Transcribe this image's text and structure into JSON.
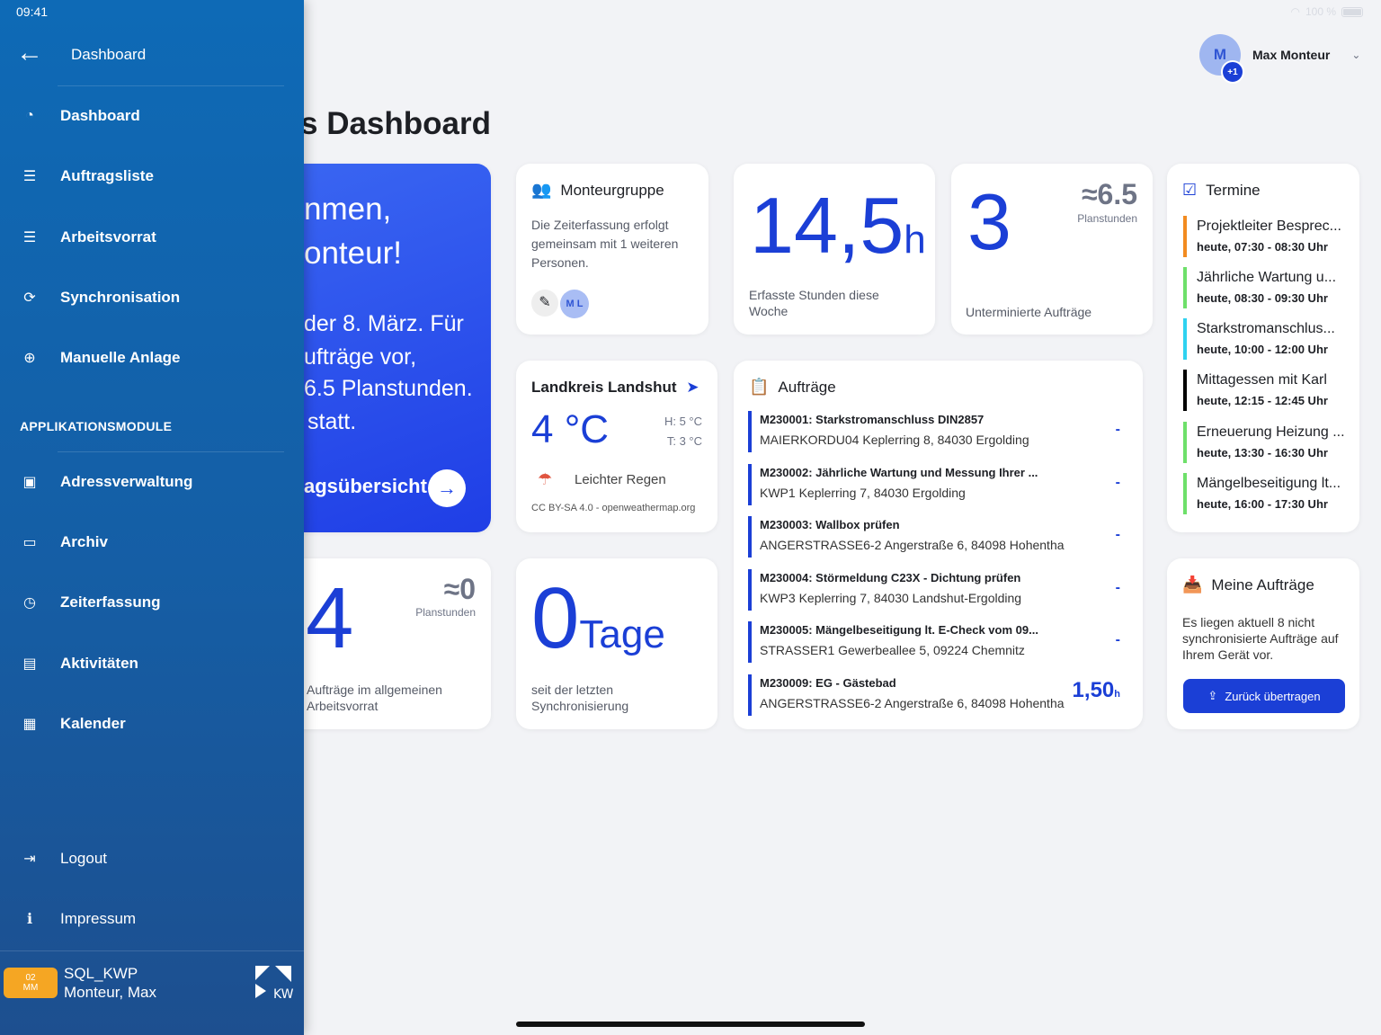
{
  "status": {
    "time": "09:41",
    "battery": "100 %"
  },
  "user": {
    "initial": "M",
    "extra": "+1",
    "name": "Max Monteur"
  },
  "page_title": "s Dashboard",
  "welcome": {
    "line1": "nmen,",
    "line2": "onteur!",
    "line3": "der 8. März. Für",
    "line4": "ufträge vor,",
    "line5": "6.5 Planstunden.",
    "line6": "statt.",
    "link": "agsübersicht"
  },
  "monteurgruppe": {
    "title": "Monteurgruppe",
    "text": "Die Zeiterfassung erfolgt gemeinsam mit 1 weiteren Personen.",
    "member_initials": "M L"
  },
  "hours": {
    "value": "14,5",
    "unit": "h",
    "label": "Erfasste Stunden diese Woche"
  },
  "unscheduled": {
    "value": "3",
    "plan_value": "≈6.5",
    "plan_label": "Planstunden",
    "label": "Unterminierte Aufträge"
  },
  "weather": {
    "title": "Landkreis Landshut",
    "temp": "4 °C",
    "high": "H: 5 °C",
    "low": "T: 3 °C",
    "desc": "Leichter Regen",
    "credit": "CC BY-SA 4.0 - openweathermap.org"
  },
  "general": {
    "value": "4",
    "plan_value": "≈0",
    "plan_label": "Planstunden",
    "label": "Aufträge im allgemeinen Arbeitsvorrat"
  },
  "sync": {
    "value": "0",
    "unit": "Tage",
    "label": "seit der letzten Synchronisierung"
  },
  "orders": {
    "title": "Aufträge",
    "items": [
      {
        "title": "M230001: Starkstromanschluss DIN2857",
        "sub": "MAIERKORDU04 Keplerring 8, 84030 Ergolding",
        "hours": "-"
      },
      {
        "title": "M230002: Jährliche Wartung und Messung Ihrer ...",
        "sub": "KWP1 Keplerring 7, 84030 Ergolding",
        "hours": "-"
      },
      {
        "title": "M230003: Wallbox prüfen",
        "sub": "ANGERSTRASSE6-2 Angerstraße 6, 84098 Hohentha",
        "hours": "-"
      },
      {
        "title": "M230004: Störmeldung C23X - Dichtung prüfen",
        "sub": "KWP3 Keplerring 7, 84030 Landshut-Ergolding",
        "hours": "-"
      },
      {
        "title": "M230005: Mängelbeseitigung lt. E-Check vom 09...",
        "sub": "STRASSER1 Gewerbeallee 5, 09224 Chemnitz",
        "hours": "-"
      },
      {
        "title": "M230009: EG - Gästebad",
        "sub": "ANGERSTRASSE6-2 Angerstraße 6, 84098 Hohentha",
        "hours": "1,50",
        "unit": "h"
      }
    ]
  },
  "termine": {
    "title": "Termine",
    "items": [
      {
        "title": "Projektleiter Besprec...",
        "time": "heute, 07:30 - 08:30 Uhr",
        "color": "#f28b20"
      },
      {
        "title": "Jährliche Wartung u...",
        "time": "heute, 08:30 - 09:30 Uhr",
        "color": "#6ee06a"
      },
      {
        "title": "Starkstromanschlus...",
        "time": "heute, 10:00 - 12:00 Uhr",
        "color": "#2fd2f0"
      },
      {
        "title": "Mittagessen mit Karl",
        "time": "heute, 12:15 - 12:45 Uhr",
        "color": "#000000"
      },
      {
        "title": "Erneuerung Heizung ...",
        "time": "heute, 13:30 - 16:30 Uhr",
        "color": "#6ee06a"
      },
      {
        "title": "Mängelbeseitigung lt...",
        "time": "heute, 16:00 - 17:30 Uhr",
        "color": "#6ee06a"
      }
    ]
  },
  "meine": {
    "title": "Meine Aufträge",
    "text": "Es liegen aktuell 8 nicht synchronisierte Aufträge auf Ihrem Gerät vor.",
    "button": "Zurück übertragen"
  },
  "sidebar": {
    "header": "Dashboard",
    "items": [
      {
        "label": "Dashboard",
        "icon": "speedometer-icon"
      },
      {
        "label": "Auftragsliste",
        "icon": "list-icon"
      },
      {
        "label": "Arbeitsvorrat",
        "icon": "list-icon"
      },
      {
        "label": "Synchronisation",
        "icon": "sync-icon"
      },
      {
        "label": "Manuelle Anlage",
        "icon": "plus-circle-icon"
      }
    ],
    "section": "APPLIKATIONSMODULE",
    "modules": [
      {
        "label": "Adressverwaltung",
        "icon": "contact-book-icon"
      },
      {
        "label": "Archiv",
        "icon": "folder-icon"
      },
      {
        "label": "Zeiterfassung",
        "icon": "stopwatch-icon"
      },
      {
        "label": "Aktivitäten",
        "icon": "clipboard-icon"
      },
      {
        "label": "Kalender",
        "icon": "calendar-icon"
      }
    ],
    "footer_items": [
      {
        "label": "Logout",
        "icon": "logout-icon"
      },
      {
        "label": "Impressum",
        "icon": "info-icon"
      }
    ],
    "badge_top": "02",
    "badge_bottom": "MM",
    "db": "SQL_KWP",
    "account": "Monteur, Max"
  }
}
